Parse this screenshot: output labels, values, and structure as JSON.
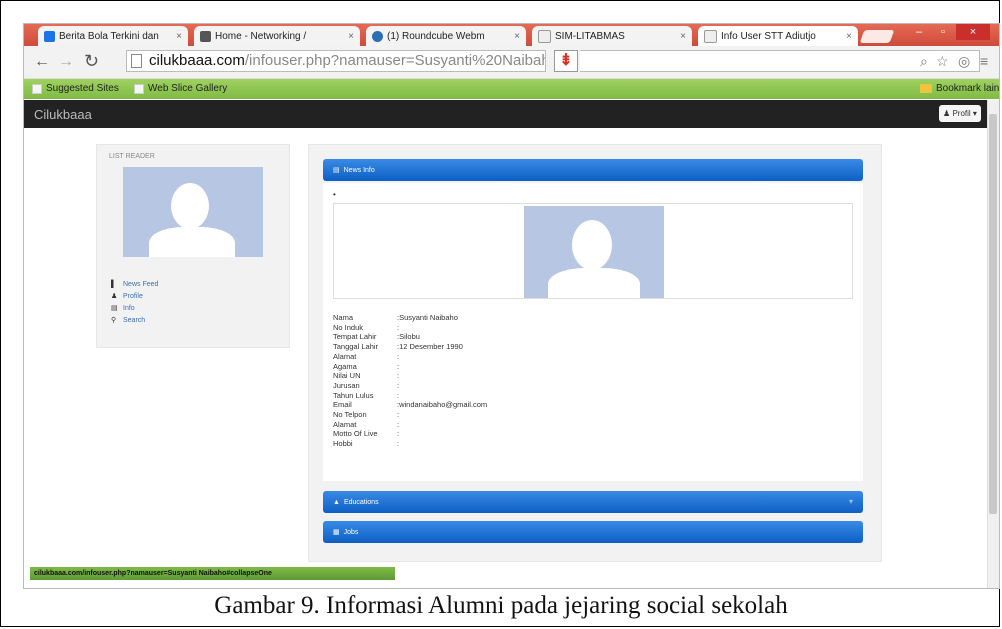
{
  "browser": {
    "tabs": [
      {
        "label": "Berita Bola Terkini dan",
        "favicon_color": "#1a73e8"
      },
      {
        "label": "Home - Networking /",
        "favicon_color": "#555555"
      },
      {
        "label": "(1) Roundcube Webm",
        "favicon_color": "#2b6fb4"
      },
      {
        "label": "SIM-LITABMAS",
        "favicon_color": "#eeeeee"
      },
      {
        "label": "Info User STT Adiutjo",
        "favicon_color": "#eeeeee"
      }
    ],
    "address": {
      "host": "cilukbaaa.com",
      "path": "/infouser.php?namauser=Susyanti%20Naibaho"
    },
    "bookmarks": [
      {
        "label": "Suggested Sites"
      },
      {
        "label": "Web Slice Gallery"
      }
    ],
    "bookmarks_other": "Bookmark lain",
    "status_url": "cilukbaaa.com/infouser.php?namauser=Susyanti Naibaho#collapseOne"
  },
  "site": {
    "brand": "Cilukbaaa",
    "user_button": "Profil"
  },
  "left_panel": {
    "title": "LIST READER",
    "menu": [
      {
        "icon": "news-icon",
        "label": "News Feed"
      },
      {
        "icon": "user-icon",
        "label": "Profile"
      },
      {
        "icon": "list-icon",
        "label": "Info"
      },
      {
        "icon": "search-icon",
        "label": "Search"
      }
    ]
  },
  "main_panel": {
    "header": "News Info",
    "bullet": "•",
    "fields": [
      {
        "label": "Nama",
        "value": ":Susyanti Naibaho"
      },
      {
        "label": "No Induk",
        "value": ":"
      },
      {
        "label": "Tempat Lahir",
        "value": ":Silobu"
      },
      {
        "label": "Tanggal Lahir",
        "value": ":12 Desember 1990"
      },
      {
        "label": "Alamat",
        "value": ":"
      },
      {
        "label": "Agama",
        "value": ":"
      },
      {
        "label": "Nilai UN",
        "value": ":"
      },
      {
        "label": "Jurusan",
        "value": ":"
      },
      {
        "label": "Tahun Lulus",
        "value": ":"
      },
      {
        "label": "Email",
        "value": ":windanaibaho@gmail.com"
      },
      {
        "label": "No Telpon",
        "value": ":"
      },
      {
        "label": "Alamat",
        "value": ":"
      },
      {
        "label": "Motto Of Live",
        "value": ":"
      },
      {
        "label": "Hobbi",
        "value": ":"
      }
    ],
    "sections": [
      {
        "label": "Educations"
      },
      {
        "label": "Jobs"
      }
    ]
  },
  "caption": "Gambar 9. Informasi Alumni pada jejaring social sekolah"
}
